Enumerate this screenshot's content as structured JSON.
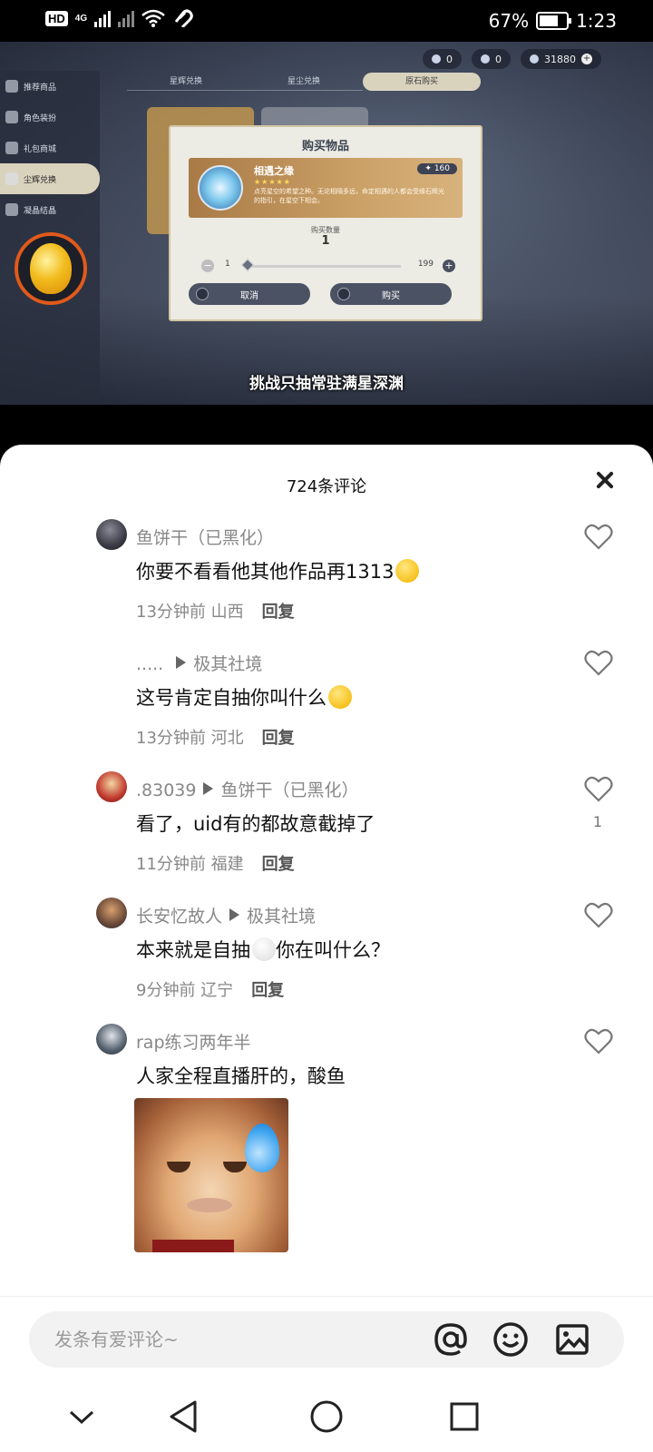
{
  "status_bar": {
    "hd_badge": "HD",
    "sim_index": "1",
    "network": "4G",
    "battery_percent": "67%",
    "time": "1:23"
  },
  "video": {
    "currencies": [
      "0",
      "0",
      "31880"
    ],
    "side_menu": [
      "推荐商品",
      "角色装扮",
      "礼包商城",
      "尘辉兑换",
      "凝晶结晶"
    ],
    "active_side_index": 3,
    "top_tabs": [
      "星辉兑换",
      "星尘兑换",
      "原石购买"
    ],
    "active_tab_index": 2,
    "dialog": {
      "title": "购买物品",
      "item_name": "相遇之缘",
      "item_stars": "★★★★★",
      "item_desc": "点亮星空的希望之种。无论相隔多远，命定相遇的人都会受缘石辉光的指引，在星空下相会。",
      "item_price": "160",
      "qty_label": "购买数量",
      "qty_value": "1",
      "qty_min": "1",
      "qty_max": "199",
      "cancel_label": "取消",
      "buy_label": "购买"
    },
    "subtitle": "挑战只抽常驻满星深渊"
  },
  "comments_sheet": {
    "title": "724条评论",
    "comments": [
      {
        "author": "鱼饼干（已黑化）",
        "reply_to": "",
        "text": "你要不看看他其他作品再1313",
        "time": "13分钟前",
        "location": "山西",
        "reply_label": "回复",
        "likes": "",
        "avatar_color": "#3b3b46"
      },
      {
        "author": "..... ",
        "reply_to": "极其社境",
        "text": "这号肯定自抽你叫什么",
        "time": "13分钟前",
        "location": "河北",
        "reply_label": "回复",
        "likes": "",
        "avatar_color": ""
      },
      {
        "author": ".83039",
        "reply_to": "鱼饼干（已黑化）",
        "text": "看了，uid有的都故意截掉了",
        "time": "11分钟前",
        "location": "福建",
        "reply_label": "回复",
        "likes": "1",
        "avatar_color": "#c23a2e"
      },
      {
        "author": "长安忆故人",
        "reply_to": "极其社境",
        "text": "本来就是自抽",
        "text_after": "你在叫什么？",
        "time": "9分钟前",
        "location": "辽宁",
        "reply_label": "回复",
        "likes": "",
        "avatar_color": "#6b4a38"
      },
      {
        "author": "rap练习两年半",
        "reply_to": "",
        "text": "人家全程直播肝的，酸鱼",
        "time": "",
        "location": "",
        "reply_label": "",
        "likes": "",
        "avatar_color": "#55606e"
      }
    ]
  },
  "input_bar": {
    "placeholder": "发条有爱评论~",
    "icons": [
      "at-icon",
      "emoji-icon",
      "image-icon"
    ]
  },
  "nav_bar": {
    "icons": [
      "collapse-chevron-icon",
      "back-triangle-icon",
      "home-circle-icon",
      "recents-square-icon"
    ]
  }
}
